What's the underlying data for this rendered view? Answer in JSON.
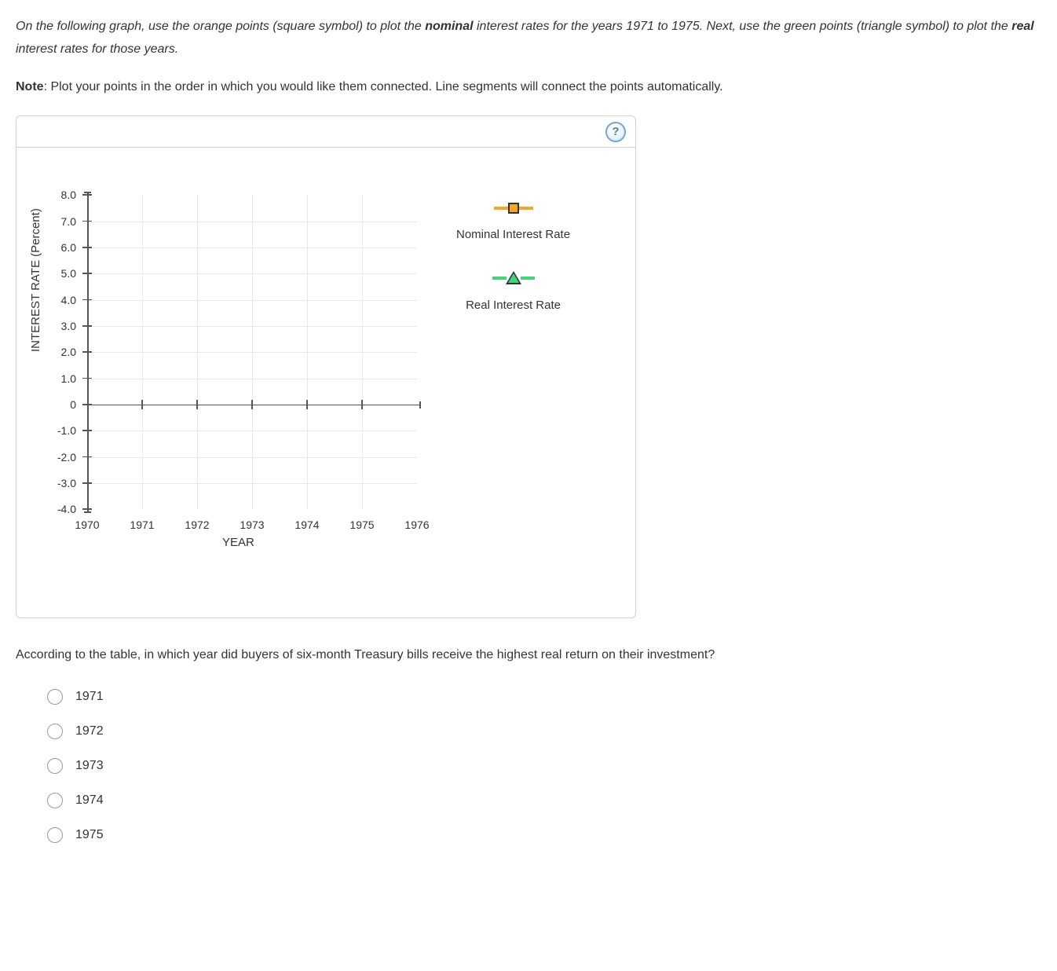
{
  "instructions": {
    "part1": "On the following graph, use the orange points (square symbol) to plot the ",
    "bold1": "nominal",
    "part2": " interest rates for the years 1971 to 1975. Next, use the green points (triangle symbol) to plot the ",
    "bold2": "real",
    "part3": " interest rates for those years."
  },
  "note": {
    "label": "Note",
    "text": ": Plot your points in the order in which you would like them connected. Line segments will connect the points automatically."
  },
  "help_glyph": "?",
  "chart_data": {
    "type": "line",
    "xlabel": "YEAR",
    "ylabel": "INTEREST RATE (Percent)",
    "x_ticks": [
      "1970",
      "1971",
      "1972",
      "1973",
      "1974",
      "1975",
      "1976"
    ],
    "y_ticks": [
      "8.0",
      "7.0",
      "6.0",
      "5.0",
      "4.0",
      "3.0",
      "2.0",
      "1.0",
      "0",
      "-1.0",
      "-2.0",
      "-3.0",
      "-4.0"
    ],
    "xlim": [
      1970,
      1976
    ],
    "ylim": [
      -4.0,
      8.0
    ],
    "zero_line_y": 0,
    "series": [
      {
        "name": "Nominal Interest Rate",
        "marker": "square",
        "color": "#f5a623",
        "values": []
      },
      {
        "name": "Real Interest Rate",
        "marker": "triangle",
        "color": "#3fd67a",
        "values": []
      }
    ]
  },
  "question": "According to the table, in which year did buyers of six-month Treasury bills receive the highest real return on their investment?",
  "options": [
    "1971",
    "1972",
    "1973",
    "1974",
    "1975"
  ]
}
